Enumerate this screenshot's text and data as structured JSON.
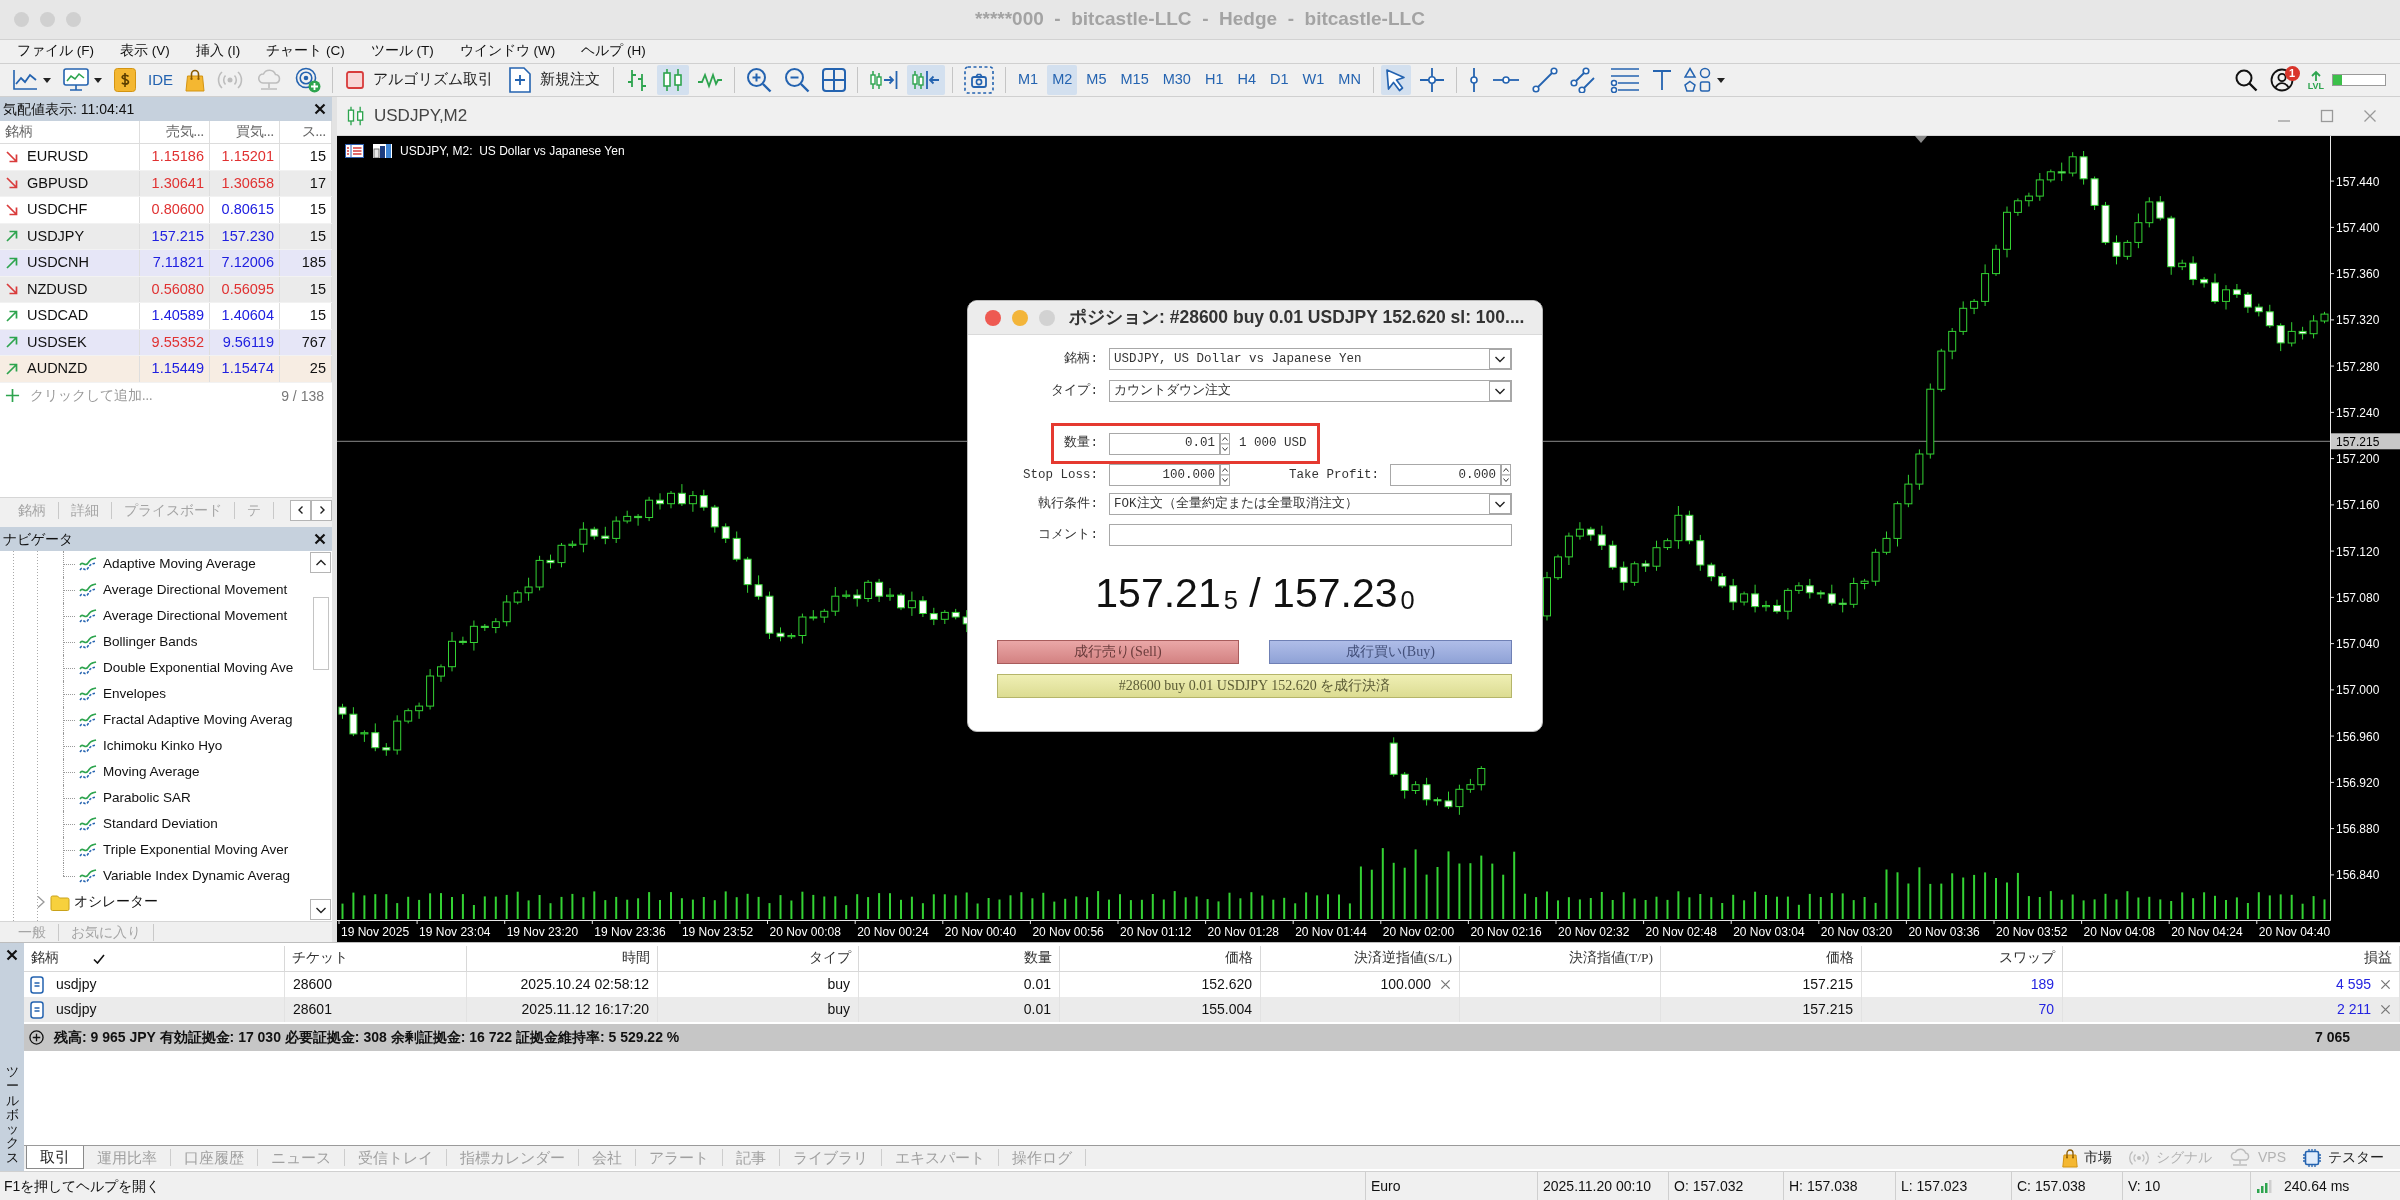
{
  "window": {
    "title": "*****000  -  bitcastle-LLC  -  Hedge  -  bitcastle-LLC",
    "active": false
  },
  "menu": [
    "ファイル (F)",
    "表示 (V)",
    "挿入 (I)",
    "チャート (C)",
    "ツール (T)",
    "ウインドウ (W)",
    "ヘルプ (H)"
  ],
  "toolbar": {
    "ide_label": "IDE",
    "algo_trading": {
      "label": "アルゴリズム取引",
      "on": false
    },
    "new_order": "新規注文",
    "chart_types": [
      {
        "selected": false
      },
      {
        "selected": true
      },
      {
        "selected": false
      }
    ],
    "autoscroll": {
      "on": false
    },
    "chart_shift": {
      "on": true
    },
    "timeframes": [
      {
        "label": "M1",
        "selected": false
      },
      {
        "label": "M2",
        "selected": true
      },
      {
        "label": "M5",
        "selected": false
      },
      {
        "label": "M15",
        "selected": false
      },
      {
        "label": "M30",
        "selected": false
      },
      {
        "label": "H1",
        "selected": false
      },
      {
        "label": "H4",
        "selected": false
      },
      {
        "label": "D1",
        "selected": false
      },
      {
        "label": "W1",
        "selected": false
      },
      {
        "label": "MN",
        "selected": false
      }
    ],
    "pointer_tools": [
      {
        "selected": true
      },
      {
        "selected": false
      }
    ],
    "notifications": "1",
    "level_label": "LVL",
    "level": 0.18
  },
  "market_watch": {
    "title": "気配値表示: 11:04:41",
    "columns": [
      "銘柄",
      "売気...",
      "買気...",
      "ス..."
    ],
    "rows": [
      {
        "symbol": "EURUSD",
        "rising": false,
        "bid": "1.15186",
        "bid_up": false,
        "ask": "1.15201",
        "ask_up": false,
        "spread": "15",
        "color": "#ffffff"
      },
      {
        "symbol": "GBPUSD",
        "rising": false,
        "bid": "1.30641",
        "bid_up": false,
        "ask": "1.30658",
        "ask_up": false,
        "spread": "17",
        "color": "#ebebeb"
      },
      {
        "symbol": "USDCHF",
        "rising": false,
        "bid": "0.80600",
        "bid_up": false,
        "ask": "0.80615",
        "ask_up": true,
        "spread": "15",
        "color": "#ffffff"
      },
      {
        "symbol": "USDJPY",
        "rising": true,
        "bid": "157.215",
        "bid_up": true,
        "ask": "157.230",
        "ask_up": true,
        "spread": "15",
        "color": "#ebebeb"
      },
      {
        "symbol": "USDCNH",
        "rising": true,
        "bid": "7.11821",
        "bid_up": true,
        "ask": "7.12006",
        "ask_up": true,
        "spread": "185",
        "color": "#e6e6f7"
      },
      {
        "symbol": "NZDUSD",
        "rising": false,
        "bid": "0.56080",
        "bid_up": false,
        "ask": "0.56095",
        "ask_up": false,
        "spread": "15",
        "color": "#ebebeb"
      },
      {
        "symbol": "USDCAD",
        "rising": true,
        "bid": "1.40589",
        "bid_up": true,
        "ask": "1.40604",
        "ask_up": true,
        "spread": "15",
        "color": "#ffffff"
      },
      {
        "symbol": "USDSEK",
        "rising": true,
        "bid": "9.55352",
        "bid_up": false,
        "ask": "9.56119",
        "ask_up": true,
        "spread": "767",
        "color": "#e6e6f7"
      },
      {
        "symbol": "AUDNZD",
        "rising": true,
        "bid": "1.15449",
        "bid_up": true,
        "ask": "1.15474",
        "ask_up": true,
        "spread": "25",
        "color": "#f7ede3"
      }
    ],
    "add_label": "クリックして追加...",
    "count": "9 / 138",
    "tabs": [
      "銘柄",
      "詳細",
      "プライスボード",
      "テ"
    ]
  },
  "navigator": {
    "title": "ナビゲータ",
    "tree": [
      {
        "children": [
          {
            "label": "Adaptive Moving Average",
            "kind": "indicator"
          },
          {
            "label": "Average Directional Movement",
            "kind": "indicator"
          },
          {
            "label": "Average Directional Movement",
            "kind": "indicator"
          },
          {
            "label": "Bollinger Bands",
            "kind": "indicator"
          },
          {
            "label": "Double Exponential Moving Ave",
            "kind": "indicator"
          },
          {
            "label": "Envelopes",
            "kind": "indicator"
          },
          {
            "label": "Fractal Adaptive Moving Averag",
            "kind": "indicator"
          },
          {
            "label": "Ichimoku Kinko Hyo",
            "kind": "indicator"
          },
          {
            "label": "Moving Average",
            "kind": "indicator"
          },
          {
            "label": "Parabolic SAR",
            "kind": "indicator"
          },
          {
            "label": "Standard Deviation",
            "kind": "indicator"
          },
          {
            "label": "Triple Exponential Moving Aver",
            "kind": "indicator"
          },
          {
            "label": "Variable Index Dynamic Averag",
            "kind": "indicator"
          }
        ]
      },
      {
        "label": "オシレーター",
        "kind": "folder",
        "expanded": false
      }
    ],
    "tabs": [
      "一般",
      "お気に入り"
    ]
  },
  "chart": {
    "tab": "USDJPY,M2",
    "symbol_label": "USDJPY, M2:  US Dollar vs Japanese Yen",
    "time_labels": [
      "19 Nov 2025",
      "19 Nov 23:04",
      "19 Nov 23:20",
      "19 Nov 23:36",
      "19 Nov 23:52",
      "20 Nov 00:08",
      "20 Nov 00:24",
      "20 Nov 00:40",
      "20 Nov 00:56",
      "20 Nov 01:12",
      "20 Nov 01:28",
      "20 Nov 01:44",
      "20 Nov 02:00",
      "20 Nov 02:16",
      "20 Nov 02:32",
      "20 Nov 02:48",
      "20 Nov 03:04",
      "20 Nov 03:20",
      "20 Nov 03:36",
      "20 Nov 03:52",
      "20 Nov 04:08",
      "20 Nov 04:24",
      "20 Nov 04:40"
    ],
    "chart_data": {
      "type": "candlestick",
      "categories": [
        null,
        null,
        null,
        null,
        null,
        null,
        null,
        null,
        null,
        null,
        null,
        null,
        null,
        null,
        null,
        null,
        null,
        null,
        null,
        null,
        null,
        null,
        null,
        null,
        null,
        null,
        null,
        null,
        null,
        null,
        null,
        null,
        null,
        null,
        null,
        null,
        null,
        null,
        null,
        null,
        null,
        null,
        null,
        null,
        null,
        null,
        null,
        null,
        null,
        null,
        null,
        null,
        null,
        null,
        null,
        null,
        null,
        null,
        null,
        null,
        null,
        null,
        null,
        null,
        null,
        null,
        null,
        null,
        null,
        null,
        null,
        null,
        null,
        null,
        null,
        null,
        null,
        null,
        null,
        null,
        null,
        null,
        null,
        null,
        null,
        null,
        null,
        null,
        null,
        null,
        null,
        null,
        null,
        null,
        null,
        null,
        null,
        null,
        null,
        null,
        null,
        null,
        null,
        null,
        null,
        null,
        null,
        null,
        null,
        null,
        null,
        null,
        null,
        null,
        null,
        null,
        null,
        null,
        null,
        null,
        null,
        null,
        null,
        null,
        null,
        null,
        null,
        null,
        null,
        null,
        null,
        null,
        null,
        null,
        null,
        null,
        null,
        null,
        null,
        null,
        null,
        null,
        null,
        null,
        null,
        null,
        null,
        null,
        null,
        null,
        null,
        null,
        null,
        null,
        null,
        null,
        null,
        null,
        null,
        null,
        null,
        null,
        null,
        null,
        null,
        null,
        null,
        null,
        null,
        null,
        null,
        null,
        null,
        null,
        null,
        null,
        null,
        null,
        null,
        null,
        null,
        null
      ],
      "ohlc": [
        [
          156.985,
          156.988,
          156.975,
          156.979
        ],
        [
          156.979,
          156.985,
          156.96,
          156.962
        ],
        [
          156.962,
          156.965,
          156.955,
          156.963
        ],
        [
          156.963,
          156.971,
          156.947,
          156.95
        ],
        [
          156.95,
          156.954,
          156.943,
          156.948
        ],
        [
          156.948,
          156.978,
          156.944,
          156.973
        ],
        [
          156.973,
          156.984,
          156.971,
          156.982
        ],
        [
          156.982,
          156.989,
          156.975,
          156.986
        ],
        [
          156.986,
          157.018,
          156.983,
          157.012
        ],
        [
          157.012,
          157.022,
          157.007,
          157.02
        ],
        [
          157.02,
          157.05,
          157.016,
          157.042
        ],
        [
          157.042,
          157.046,
          157.039,
          157.041
        ],
        [
          157.041,
          157.06,
          157.034,
          157.055
        ],
        [
          157.055,
          157.057,
          157.051,
          157.054
        ],
        [
          157.054,
          157.062,
          157.049,
          157.059
        ],
        [
          157.059,
          157.082,
          157.055,
          157.076
        ],
        [
          157.076,
          157.086,
          157.074,
          157.084
        ],
        [
          157.084,
          157.097,
          157.077,
          157.089
        ],
        [
          157.089,
          157.116,
          157.086,
          157.112
        ],
        [
          157.112,
          157.117,
          157.105,
          157.11
        ],
        [
          157.11,
          157.127,
          157.106,
          157.125
        ],
        [
          157.125,
          157.129,
          157.123,
          157.126
        ],
        [
          157.126,
          157.145,
          157.119,
          157.139
        ],
        [
          157.139,
          157.141,
          157.13,
          157.133
        ],
        [
          157.133,
          157.141,
          157.126,
          157.131
        ],
        [
          157.131,
          157.15,
          157.127,
          157.146
        ],
        [
          157.146,
          157.155,
          157.144,
          157.15
        ],
        [
          157.15,
          157.152,
          157.142,
          157.149
        ],
        [
          157.149,
          157.167,
          157.146,
          157.164
        ],
        [
          157.164,
          157.17,
          157.156,
          157.161
        ],
        [
          157.161,
          157.172,
          157.157,
          157.17
        ],
        [
          157.17,
          157.178,
          157.159,
          157.161
        ],
        [
          157.161,
          157.172,
          157.154,
          157.168
        ],
        [
          157.168,
          157.173,
          157.155,
          157.158
        ],
        [
          157.158,
          157.16,
          157.136,
          157.141
        ],
        [
          157.141,
          157.144,
          157.127,
          157.131
        ],
        [
          157.131,
          157.137,
          157.111,
          157.113
        ],
        [
          157.113,
          157.115,
          157.084,
          157.091
        ],
        [
          157.091,
          157.099,
          157.078,
          157.081
        ],
        [
          157.081,
          157.085,
          157.044,
          157.049
        ],
        [
          157.049,
          157.054,
          157.042,
          157.046
        ],
        [
          157.046,
          157.049,
          157.044,
          157.047
        ],
        [
          157.047,
          157.066,
          157.04,
          157.063
        ],
        [
          157.063,
          157.069,
          157.06,
          157.063
        ],
        [
          157.063,
          157.07,
          157.058,
          157.068
        ],
        [
          157.068,
          157.089,
          157.064,
          157.081
        ],
        [
          157.081,
          157.086,
          157.079,
          157.082
        ],
        [
          157.082,
          157.087,
          157.072,
          157.079
        ],
        [
          157.079,
          157.095,
          157.076,
          157.093
        ],
        [
          157.093,
          157.096,
          157.076,
          157.081
        ],
        [
          157.081,
          157.088,
          157.077,
          157.082
        ],
        [
          157.082,
          157.084,
          157.069,
          157.071
        ],
        [
          157.071,
          157.085,
          157.064,
          157.077
        ],
        [
          157.077,
          157.081,
          157.063,
          157.066
        ],
        [
          157.066,
          157.071,
          157.056,
          157.061
        ],
        [
          157.061,
          157.069,
          157.057,
          157.067
        ],
        [
          157.067,
          157.07,
          157.061,
          157.063
        ],
        [
          157.063,
          157.069,
          157.05,
          157.057
        ],
        null,
        null,
        null,
        null,
        null,
        null,
        null,
        null,
        null,
        null,
        null,
        null,
        null,
        null,
        null,
        null,
        null,
        null,
        null,
        null,
        null,
        null,
        null,
        null,
        null,
        null,
        null,
        null,
        null,
        null,
        null,
        null,
        null,
        null,
        null,
        null,
        null,
        null,
        [
          156.954,
          156.959,
          156.925,
          156.927
        ],
        [
          156.927,
          156.929,
          156.906,
          156.913
        ],
        [
          156.913,
          156.921,
          156.91,
          156.918
        ],
        [
          156.918,
          156.924,
          156.9,
          156.905
        ],
        [
          156.905,
          156.907,
          156.9,
          156.904
        ],
        [
          156.904,
          156.912,
          156.897,
          156.899
        ],
        [
          156.899,
          156.918,
          156.892,
          156.914
        ],
        [
          156.914,
          156.923,
          156.911,
          156.918
        ],
        [
          156.918,
          156.934,
          156.913,
          156.932
        ],
        null,
        null,
        null,
        null,
        null,
        [
          157.064,
          157.102,
          157.06,
          157.097
        ],
        [
          157.097,
          157.117,
          157.095,
          157.115
        ],
        [
          157.115,
          157.136,
          157.108,
          157.133
        ],
        [
          157.133,
          157.145,
          157.13,
          157.139
        ],
        [
          157.139,
          157.141,
          157.129,
          157.134
        ],
        [
          157.134,
          157.142,
          157.121,
          157.125
        ],
        [
          157.125,
          157.129,
          157.104,
          157.106
        ],
        [
          157.106,
          157.111,
          157.086,
          157.093
        ],
        [
          157.093,
          157.111,
          157.09,
          157.109
        ],
        [
          157.109,
          157.112,
          157.102,
          157.107
        ],
        [
          157.107,
          157.129,
          157.103,
          157.123
        ],
        [
          157.123,
          157.131,
          157.121,
          157.129
        ],
        [
          157.129,
          157.159,
          157.122,
          157.151
        ],
        [
          157.151,
          157.155,
          157.126,
          157.129
        ],
        [
          157.129,
          157.134,
          157.103,
          157.108
        ],
        [
          157.108,
          157.11,
          157.094,
          157.098
        ],
        [
          157.098,
          157.101,
          157.088,
          157.09
        ],
        [
          157.09,
          157.096,
          157.069,
          157.076
        ],
        [
          157.076,
          157.085,
          157.073,
          157.083
        ],
        [
          157.083,
          157.091,
          157.067,
          157.072
        ],
        [
          157.072,
          157.077,
          157.068,
          157.073
        ],
        [
          157.073,
          157.078,
          157.066,
          157.068
        ],
        [
          157.068,
          157.088,
          157.061,
          157.086
        ],
        [
          157.086,
          157.093,
          157.083,
          157.09
        ],
        [
          157.09,
          157.096,
          157.079,
          157.084
        ],
        [
          157.084,
          157.086,
          157.079,
          157.083
        ],
        [
          157.083,
          157.091,
          157.073,
          157.075
        ],
        [
          157.075,
          157.079,
          157.067,
          157.074
        ],
        [
          157.074,
          157.097,
          157.071,
          157.092
        ],
        [
          157.092,
          157.096,
          157.087,
          157.094
        ],
        [
          157.094,
          157.122,
          157.09,
          157.119
        ],
        [
          157.119,
          157.137,
          157.117,
          157.131
        ],
        [
          157.131,
          157.163,
          157.124,
          157.161
        ],
        [
          157.161,
          157.186,
          157.158,
          157.178
        ],
        [
          157.178,
          157.208,
          157.173,
          157.204
        ],
        [
          157.204,
          157.265,
          157.2,
          157.26
        ],
        [
          157.26,
          157.295,
          157.258,
          157.293
        ],
        [
          157.293,
          157.313,
          157.286,
          157.31
        ],
        [
          157.31,
          157.336,
          157.307,
          157.33
        ],
        [
          157.33,
          157.338,
          157.325,
          157.336
        ],
        [
          157.336,
          157.368,
          157.332,
          157.36
        ],
        [
          157.36,
          157.385,
          157.358,
          157.381
        ],
        [
          157.381,
          157.418,
          157.374,
          157.413
        ],
        [
          157.413,
          157.425,
          157.41,
          157.423
        ],
        [
          157.423,
          157.43,
          157.418,
          157.427
        ],
        [
          157.427,
          157.447,
          157.423,
          157.441
        ],
        [
          157.441,
          157.45,
          157.439,
          157.448
        ],
        [
          157.448,
          157.456,
          157.44,
          157.447
        ],
        [
          157.447,
          157.465,
          157.444,
          157.461
        ],
        [
          157.461,
          157.466,
          157.437,
          157.442
        ],
        [
          157.442,
          157.444,
          157.415,
          157.419
        ],
        [
          157.419,
          157.422,
          157.385,
          157.387
        ],
        [
          157.387,
          157.393,
          157.368,
          157.375
        ],
        [
          157.375,
          157.389,
          157.372,
          157.387
        ],
        [
          157.387,
          157.412,
          157.382,
          157.404
        ],
        [
          157.404,
          157.426,
          157.4,
          157.422
        ],
        [
          157.422,
          157.427,
          157.406,
          157.408
        ],
        [
          157.408,
          157.41,
          157.359,
          157.366
        ],
        [
          157.366,
          157.372,
          157.363,
          157.369
        ],
        [
          157.369,
          157.375,
          157.35,
          157.355
        ],
        [
          157.355,
          157.357,
          157.348,
          157.352
        ],
        [
          157.352,
          157.36,
          157.334,
          157.336
        ],
        [
          157.336,
          157.35,
          157.329,
          157.346
        ],
        [
          157.346,
          157.351,
          157.339,
          157.342
        ],
        [
          157.342,
          157.344,
          157.326,
          157.331
        ],
        [
          157.331,
          157.334,
          157.323,
          157.327
        ],
        [
          157.327,
          157.333,
          157.313,
          157.315
        ],
        [
          157.315,
          157.317,
          157.293,
          157.3
        ],
        [
          157.3,
          157.318,
          157.297,
          157.31
        ],
        [
          157.31,
          157.314,
          157.303,
          157.308
        ],
        [
          157.308,
          157.324,
          157.304,
          157.319
        ],
        [
          157.319,
          157.327,
          157.317,
          157.325
        ]
      ],
      "ylim": [
        156.801,
        157.479
      ],
      "yticks": [
        {
          "value": 157.44,
          "label": "157.440"
        },
        {
          "value": 157.4,
          "label": "157.400"
        },
        {
          "value": 157.36,
          "label": "157.360"
        },
        {
          "value": 157.32,
          "label": "157.320"
        },
        {
          "value": 157.28,
          "label": "157.280"
        },
        {
          "value": 157.24,
          "label": "157.240"
        },
        {
          "value": 157.2,
          "label": "157.200"
        },
        {
          "value": 157.16,
          "label": "157.160"
        },
        {
          "value": 157.12,
          "label": "157.120"
        },
        {
          "value": 157.08,
          "label": "157.080"
        },
        {
          "value": 157.04,
          "label": "157.040"
        },
        {
          "value": 157.0,
          "label": "157.000"
        },
        {
          "value": 156.96,
          "label": "156.960"
        },
        {
          "value": 156.92,
          "label": "156.920"
        },
        {
          "value": 156.88,
          "label": "156.880"
        },
        {
          "value": 156.84,
          "label": "156.840"
        }
      ],
      "ref_lines": [
        {
          "axis": "y",
          "value": 157.215,
          "label": "157.215"
        }
      ]
    }
  },
  "position_dialog": {
    "title": "ポジション: #28600 buy 0.01 USDJPY 152.620 sl: 100....",
    "active": true,
    "symbol": {
      "label": "銘柄:",
      "value": "USDJPY, US Dollar vs Japanese Yen"
    },
    "order_type": {
      "label": "タイプ:",
      "value": "カウントダウン注文"
    },
    "volume": {
      "label": "数量:",
      "value": "0.01",
      "note": "1 000 USD",
      "highlighted": true
    },
    "stop_loss": {
      "label": "Stop Loss:",
      "value": "100.000"
    },
    "take_profit": {
      "label": "Take Profit:",
      "value": "0.000"
    },
    "fill_policy": {
      "label": "執行条件:",
      "value": "FOK注文（全量約定または全量取消注文）"
    },
    "comment": {
      "label": "コメント:"
    },
    "prices": "157.21$_{5}$ / 157.23$_{0}$",
    "sell_button": "成行売り(Sell)",
    "buy_button": "成行買い(Buy)",
    "close_button": "#28600 buy 0.01 USDJPY 152.620 を成行決済"
  },
  "toolbox": {
    "title": "ツールボックス",
    "columns": [
      {
        "label": "銘柄",
        "sorted": true
      },
      {
        "label": "チケット",
        "sorted": false
      },
      {
        "label": "時間",
        "sorted": false
      },
      {
        "label": "タイプ",
        "sorted": false
      },
      {
        "label": "数量",
        "sorted": false
      },
      {
        "label": "価格",
        "sorted": false
      },
      {
        "label": "決済逆指値(S/L)",
        "sorted": false
      },
      {
        "label": "決済指値(T/P)",
        "sorted": false
      },
      {
        "label": "価格",
        "sorted": false
      },
      {
        "label": "スワップ",
        "sorted": false
      },
      {
        "label": "損益",
        "sorted": false
      }
    ],
    "positions": [
      {
        "symbol": "usdjpy",
        "ticket": "28600",
        "time": "2025.10.24 02:58:12",
        "type": "buy",
        "volume": "0.01",
        "open_price": "152.620",
        "stop_loss": "100.000",
        "price": "157.215",
        "swap": "189",
        "profit": "4 595"
      },
      {
        "symbol": "usdjpy",
        "ticket": "28601",
        "time": "2025.11.12 16:17:20",
        "type": "buy",
        "volume": "0.01",
        "open_price": "155.004",
        "price": "157.215",
        "swap": "70",
        "profit": "2 211"
      }
    ],
    "summary": "残高: 9 965 JPY 有効証拠金: 17 030 必要証拠金: 308 余剰証拠金: 16 722 証拠金維持率: 5 529.22 %",
    "total_profit": "7 065",
    "tabs": [
      {
        "label": "取引",
        "selected": true
      },
      {
        "label": "運用比率",
        "selected": false
      },
      {
        "label": "口座履歴",
        "selected": false
      },
      {
        "label": "ニュース",
        "selected": false
      },
      {
        "label": "受信トレイ",
        "selected": false
      },
      {
        "label": "指標カレンダー",
        "selected": false
      },
      {
        "label": "会社",
        "selected": false
      },
      {
        "label": "アラート",
        "selected": false
      },
      {
        "label": "記事",
        "selected": false
      },
      {
        "label": "ライブラリ",
        "selected": false
      },
      {
        "label": "エキスパート",
        "selected": false
      },
      {
        "label": "操作ログ",
        "selected": false
      }
    ],
    "services": [
      {
        "label": "市場",
        "disabled": false
      },
      {
        "label": "シグナル",
        "disabled": true
      },
      {
        "label": "VPS",
        "disabled": true
      },
      {
        "label": "テスター",
        "disabled": false
      }
    ]
  },
  "status_bar": {
    "help": "F1を押してヘルプを開く",
    "fields": [
      "Euro",
      "2025.11.20 00:10",
      "O: 157.032",
      "H: 157.038",
      "L: 157.023",
      "C: 157.038",
      "V: 10"
    ],
    "ping": "240.64 ms"
  }
}
